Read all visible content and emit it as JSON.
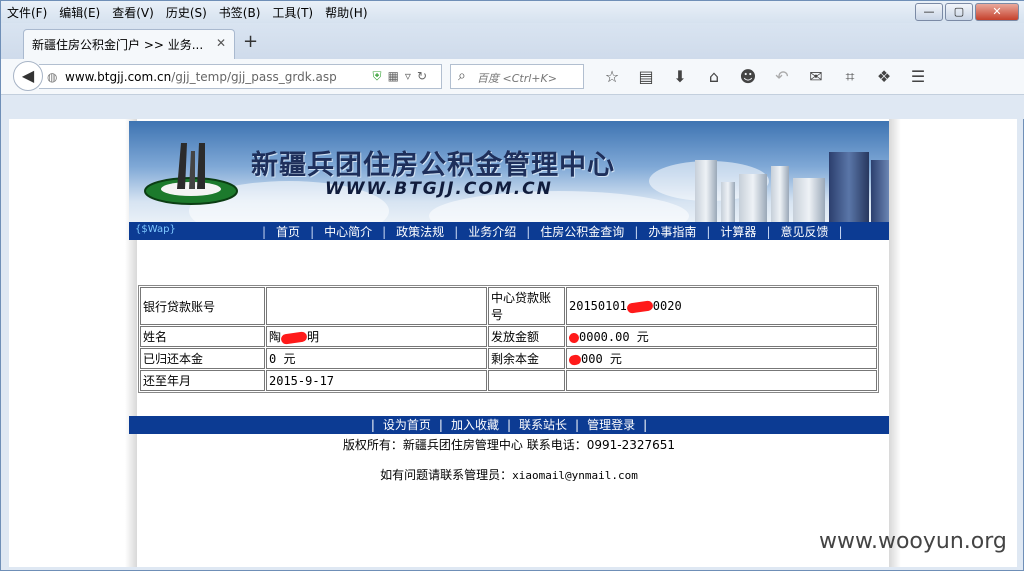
{
  "menu": [
    "文件(F)",
    "编辑(E)",
    "查看(V)",
    "历史(S)",
    "书签(B)",
    "工具(T)",
    "帮助(H)"
  ],
  "window_controls": {
    "minimize": "—",
    "maximize": "▢",
    "close": "✕"
  },
  "tab": {
    "title": "新疆住房公积金门户 >> 业务...",
    "close": "✕",
    "new": "+"
  },
  "url": {
    "host": "www.btgjj.com.cn",
    "path": "/gjj_temp/gjj_pass_grdk.asp"
  },
  "search": {
    "placeholder": "百度 <Ctrl+K>"
  },
  "banner": {
    "title": "新疆兵团住房公积金管理中心",
    "domain": "WWW.BTGJJ.COM.CN"
  },
  "nav": {
    "wap": "{$Wap}",
    "items": [
      "首页",
      "中心简介",
      "政策法规",
      "业务介绍",
      "住房公积金查询",
      "办事指南",
      "计算器",
      "意见反馈"
    ]
  },
  "loan": {
    "bank_account_label": "银行贷款账号",
    "bank_account_value": "",
    "center_account_label": "中心贷款账号",
    "center_account_prefix": "20150101",
    "center_account_suffix": "0020",
    "name_label": "姓名",
    "name_prefix": "陶",
    "name_suffix": "明",
    "issued_label": "发放金额",
    "issued_value": "0000.00 元",
    "repaid_label": "已归还本金",
    "repaid_value": "0 元",
    "remaining_label": "剩余本金",
    "remaining_value": "000 元",
    "until_label": "还至年月",
    "until_value": "2015-9-17"
  },
  "footer": {
    "links": [
      "设为首页",
      "加入收藏",
      "联系站长",
      "管理登录"
    ],
    "copyright": "版权所有：新疆兵团住房管理中心 联系电话：0991-2327651",
    "contact_label": "如有问题请联系管理员：",
    "contact_email": "xiaomail@ynmail.com"
  },
  "watermark": "www.wooyun.org",
  "colors": {
    "nav_bg": "#0c3b93",
    "redaction": "#ff1a1a"
  }
}
